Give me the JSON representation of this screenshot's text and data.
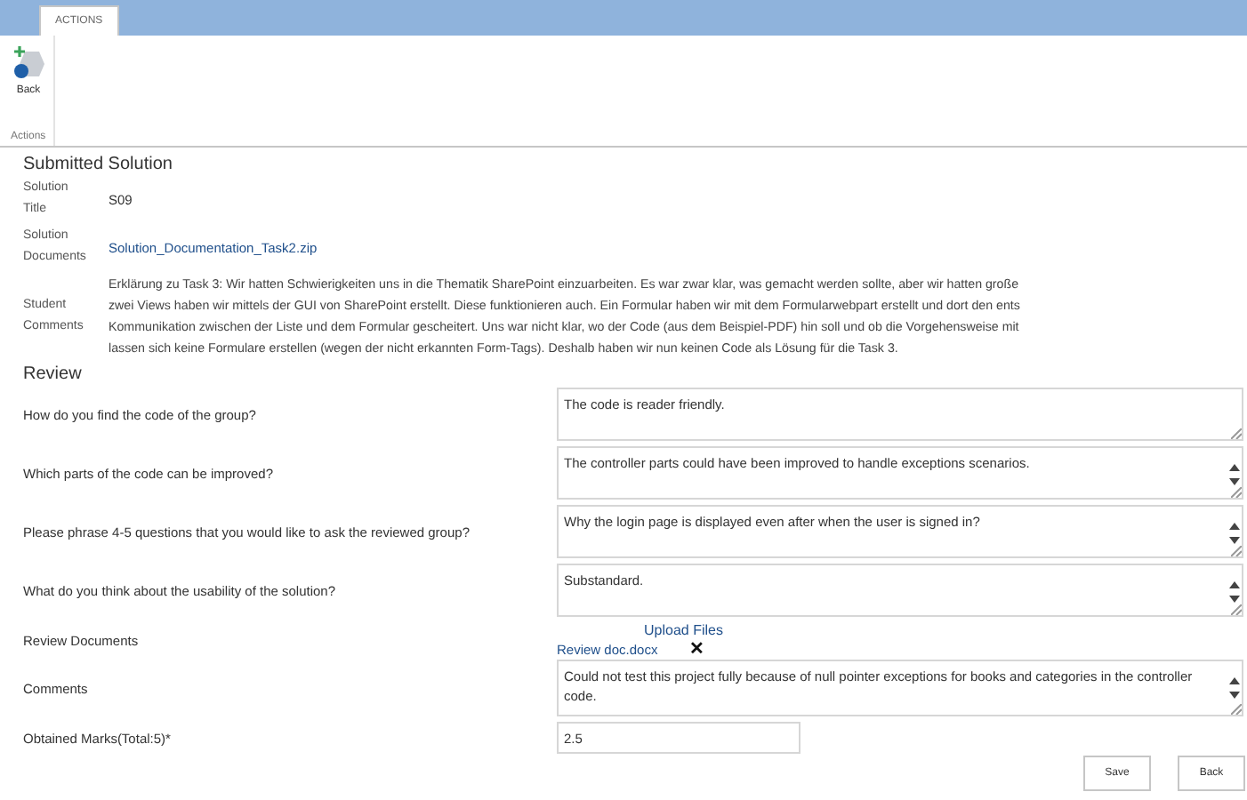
{
  "ribbon": {
    "tabs": [
      {
        "label": "ACTIONS",
        "selected": true
      }
    ],
    "buttons": [
      {
        "label": "Back"
      }
    ],
    "group_label": "Actions"
  },
  "submitted_solution": {
    "heading": "Submitted Solution",
    "fields": [
      {
        "label": [
          "Solution",
          "Title"
        ],
        "kind": "text",
        "value": "S09"
      },
      {
        "label": [
          "Solution",
          "Documents"
        ],
        "kind": "link",
        "value": "Solution_Documentation_Task2.zip"
      },
      {
        "label": [
          "Student",
          "Comments"
        ],
        "kind": "paragraph",
        "lines": [
          "Erklärung zu Task 3: Wir hatten Schwierigkeiten uns in die Thematik SharePoint einzuarbeiten. Es war zwar klar, was gemacht werden sollte, aber wir hatten große",
          "zwei Views haben wir mittels der GUI von SharePoint erstellt. Diese funktionieren auch. Ein Formular haben wir mit dem Formularwebpart erstellt und dort den ents",
          "Kommunikation zwischen der Liste und dem Formular gescheitert. Uns war nicht klar, wo der Code (aus dem Beispiel-PDF) hin soll und ob die Vorgehensweise mit",
          "lassen sich keine Formulare erstellen (wegen der nicht erkannten Form-Tags). Deshalb haben wir nun keinen Code als Lösung für die Task 3."
        ]
      }
    ]
  },
  "review": {
    "heading": "Review",
    "questions": [
      {
        "label": "How do you find the code of the group?",
        "value": "The code is reader friendly.",
        "scrollbar": false
      },
      {
        "label": "Which parts of the code can be improved?",
        "value": "The controller parts could have been improved to handle exceptions scenarios.",
        "scrollbar": true
      },
      {
        "label": "Please phrase 4-5 questions that you would like to ask the reviewed group?",
        "value": "Why the login page is displayed even after when the user is signed in?",
        "scrollbar": true
      },
      {
        "label": "What do you think about the usability of the solution?",
        "value": "Substandard.",
        "scrollbar": true
      }
    ]
  },
  "review_documents": {
    "heading": "Review Documents",
    "upload_link": "Upload Files",
    "files": [
      {
        "name": "Review doc.docx",
        "remove": "✕"
      }
    ]
  },
  "comments": {
    "label": "Comments",
    "value": "Could not test this project fully because of null pointer exceptions for books and categories in the controller code.",
    "scrollbar": true
  },
  "marks": {
    "label": "Obtained Marks(Total:5)*",
    "value": "2.5"
  },
  "buttons": [
    "Save",
    "Back"
  ]
}
